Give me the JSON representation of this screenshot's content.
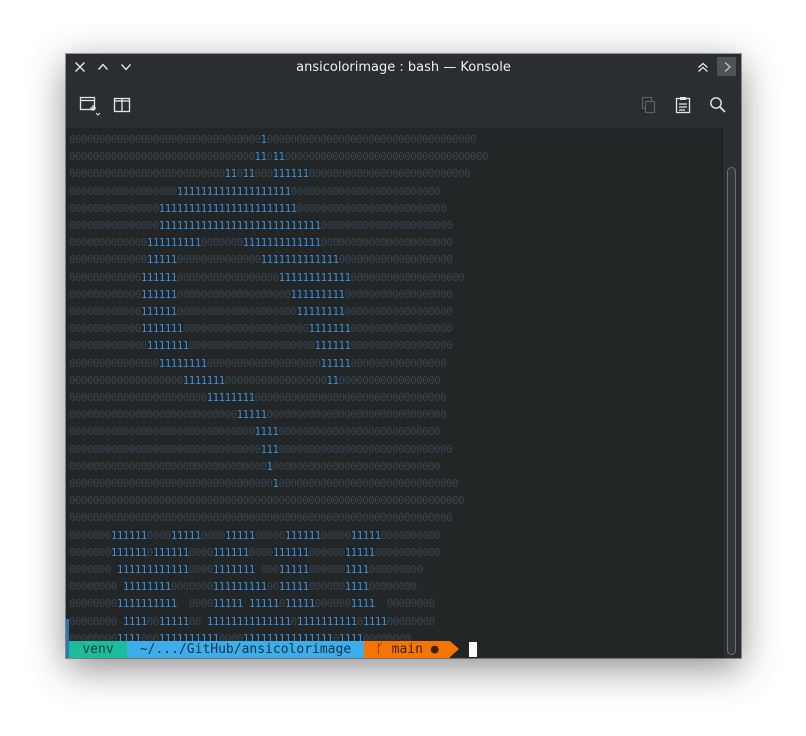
{
  "window": {
    "title": "ansicolorimage : bash — Konsole"
  },
  "titlebar": {
    "close_icon": "close-icon",
    "up_icon": "chevron-up-icon",
    "down_icon": "chevron-down-icon",
    "keep_above_icon": "double-chevron-up-icon",
    "next_icon": "chevron-right-icon"
  },
  "toolbar": {
    "new_tab_icon": "new-tab-icon",
    "split_view_icon": "split-view-icon",
    "copy_icon": "copy-icon",
    "paste_icon": "paste-icon",
    "search_icon": "search-icon"
  },
  "terminal": {
    "art_lines": [
      "00000000000000000000000000000000100000000000000000000000000000000000",
      "0000000000000000000000000000000110110000000000000000000000000000000000",
      "0000000000000000000000000011011000111111000000000000000000000000000",
      "00000000000000000011111111111111111110000000000000000000000000",
      "000000000000000111111111111111111111110000000000000000000000000",
      "0000000000000001111111111111111111111111110000000000000000000000",
      "0000000000000111111111000000011111111111110000000000000000000000",
      "0000000000000111110000000000000011111111111110000000000000000000",
      "000000000000111111000000000000000001111111111110000000000000000000",
      "0000000000001111110000000000000000000111111111000000000000000000",
      "0000000000001111110000000000000000000011111111000000000000000000",
      "0000000000001111111000000000000000000000111111100000000000000000",
      "0000000000000111111100000000000000000000011111100000000000000000",
      "000000000000000111111110000000000000000000111110000000000000000",
      "00000000000000000001111111000000000000000001100000000000000000",
      "000000000000000000000001111111100000000000000000000000000000000",
      "000000000000000000000000000011111000000000000000000000000000000",
      "00000000000000000000000000000001111000000000000000000000000000",
      "0000000000000000000000000000000011100000000000000000000000000000",
      "00000000000000000000000000000000010000000000000000000000000000",
      "00000000000000000000000000000000001000000000000000000000000000000",
      "000000000000000000000000000000000000000000000000000000000000000000",
      "0000000000000000000000000000000000000000000000000000000000000000",
      "00000001111110000111110000111110000011111100000111110000000000",
      "00000001111110111111000011111100001111110000001111100000000000",
      "0000000 11111111111100001111111 000111110000001111000000000",
      "00000000 1111111100000001111111110011111000000111100000000",
      "000000001111111111  000011111 111110111110000001111  00000000",
      "00000000 1111001111100 11111111111111011111111110111100000000",
      "000000001111000111111111100001111111111111110111100000000"
    ],
    "prompt": {
      "venv": "venv",
      "path": "~/.../GitHub/ansicolorimage",
      "branch": "ᚴ main ●"
    }
  },
  "colors": {
    "venv": "#1abc9c",
    "path": "#3daee9",
    "git": "#f67400",
    "art_bright": "#3d8fd6",
    "art_dim": "#3a4450"
  }
}
